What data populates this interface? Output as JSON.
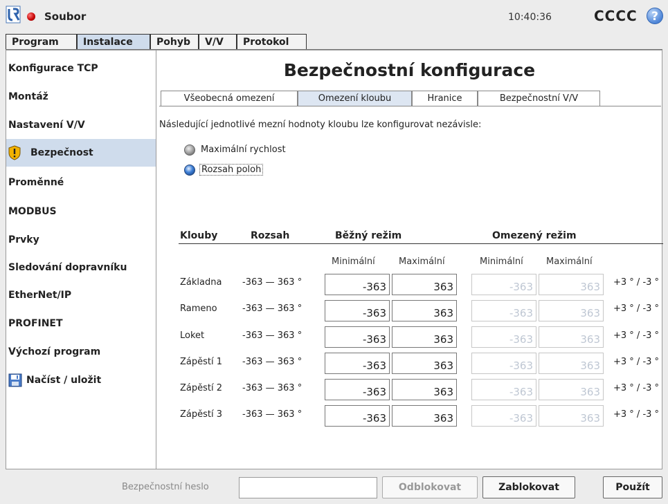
{
  "topbar": {
    "file_menu": "Soubor",
    "time": "10:40:36",
    "robot_name": "CCCC",
    "help": "?"
  },
  "main_tabs": [
    "Program",
    "Instalace",
    "Pohyb",
    "V/V",
    "Protokol"
  ],
  "sidebar": {
    "items": [
      "Konfigurace TCP",
      "Montáž",
      "Nastavení V/V",
      "Bezpečnost",
      "Proměnné",
      "MODBUS",
      "Prvky",
      "Sledování dopravníku",
      "EtherNet/IP",
      "PROFINET",
      "Výchozí program",
      "Načíst / uložit"
    ]
  },
  "content": {
    "title": "Bezpečnostní konfigurace",
    "sub_tabs": [
      "Všeobecná omezení",
      "Omezení kloubu",
      "Hranice",
      "Bezpečnostní V/V"
    ],
    "intro": "Následující jednotlivé mezní hodnoty kloubu lze konfigurovat nezávisle:",
    "radio_speed": "Maximální rychlost",
    "radio_range": "Rozsah poloh",
    "headers": {
      "joints": "Klouby",
      "range": "Rozsah",
      "normal": "Běžný režim",
      "reduced": "Omezený režim"
    },
    "subheaders": {
      "normal_min": "Minimální",
      "normal_max": "Maximální",
      "reduced_min": "Minimální",
      "reduced_max": "Maximální"
    },
    "rows": [
      {
        "joint": "Základna",
        "range": "-363 — 363 °",
        "normal_min": "-363",
        "normal_max": "363",
        "reduced_min": "-363",
        "reduced_max": "363",
        "tolerance": "+3 ° / -3 °"
      },
      {
        "joint": "Rameno",
        "range": "-363 — 363 °",
        "normal_min": "-363",
        "normal_max": "363",
        "reduced_min": "-363",
        "reduced_max": "363",
        "tolerance": "+3 ° / -3 °"
      },
      {
        "joint": "Loket",
        "range": "-363 — 363 °",
        "normal_min": "-363",
        "normal_max": "363",
        "reduced_min": "-363",
        "reduced_max": "363",
        "tolerance": "+3 ° / -3 °"
      },
      {
        "joint": "Zápěstí 1",
        "range": "-363 — 363 °",
        "normal_min": "-363",
        "normal_max": "363",
        "reduced_min": "-363",
        "reduced_max": "363",
        "tolerance": "+3 ° / -3 °"
      },
      {
        "joint": "Zápěstí 2",
        "range": "-363 — 363 °",
        "normal_min": "-363",
        "normal_max": "363",
        "reduced_min": "-363",
        "reduced_max": "363",
        "tolerance": "+3 ° / -3 °"
      },
      {
        "joint": "Zápěstí 3",
        "range": "-363 — 363 °",
        "normal_min": "-363",
        "normal_max": "363",
        "reduced_min": "-363",
        "reduced_max": "363",
        "tolerance": "+3 ° / -3 °"
      }
    ]
  },
  "bottombar": {
    "password_label": "Bezpečnostní heslo",
    "password_value": "",
    "unlock": "Odblokovat",
    "lock": "Zablokovat",
    "apply": "Použít"
  }
}
